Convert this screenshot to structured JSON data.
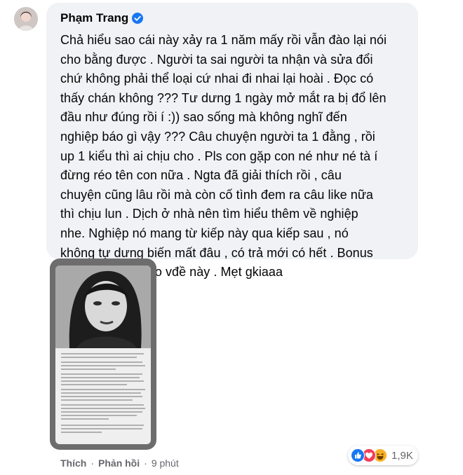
{
  "comment": {
    "author": "Phạm Trang",
    "text": "Chả hiểu sao cái này xảy ra 1 năm mấy rồi vẫn đào lại nói\ncho bằng được . Người ta sai người ta nhận và sửa đổi\nchứ không phải thể loại cứ nhai đi nhai lại hoài . Đọc có\nthấy chán không ??? Tư dưng 1 ngày mở mắt ra bị đổ lên\nđầu như đúng rồi í :)) sao sống mà không nghĩ đến\nnghiệp báo gì vậy ??? Câu chuyện người ta 1 đằng , rồi\nup 1 kiểu thì ai chịu cho . Pls con gặp con né như né tà í\nđừng réo tên con nữa . Ngta đã giải thích rồi , câu\nchuyện cũng lâu rồi mà còn cố tình đem ra câu like nữa\nthì chịu lun . Dịch ở nhà nên tìm hiểu thêm về nghiệp\nnhe. Nghiệp nó mang từ kiếp này qua kiếp sau , nó\nkhông tự dưng biến mất đâu , có trả mới có hết . Bonus\nthêm quả ảnh cho vđề này . Mẹt gkiaaa"
  },
  "actions": {
    "like": "Thích",
    "reply": "Phản hồi",
    "separator": "·",
    "time": "9 phút"
  },
  "reactions": {
    "count": "1,9K",
    "icons": [
      "like-icon",
      "love-icon",
      "haha-icon"
    ],
    "colors": {
      "like": "#1877f2",
      "love": "#f33e58",
      "haha": "#f7b125"
    }
  },
  "colors": {
    "bubble": "#f0f2f5",
    "text": "#050505",
    "muted": "#65676b",
    "verified": "#1877f2"
  }
}
